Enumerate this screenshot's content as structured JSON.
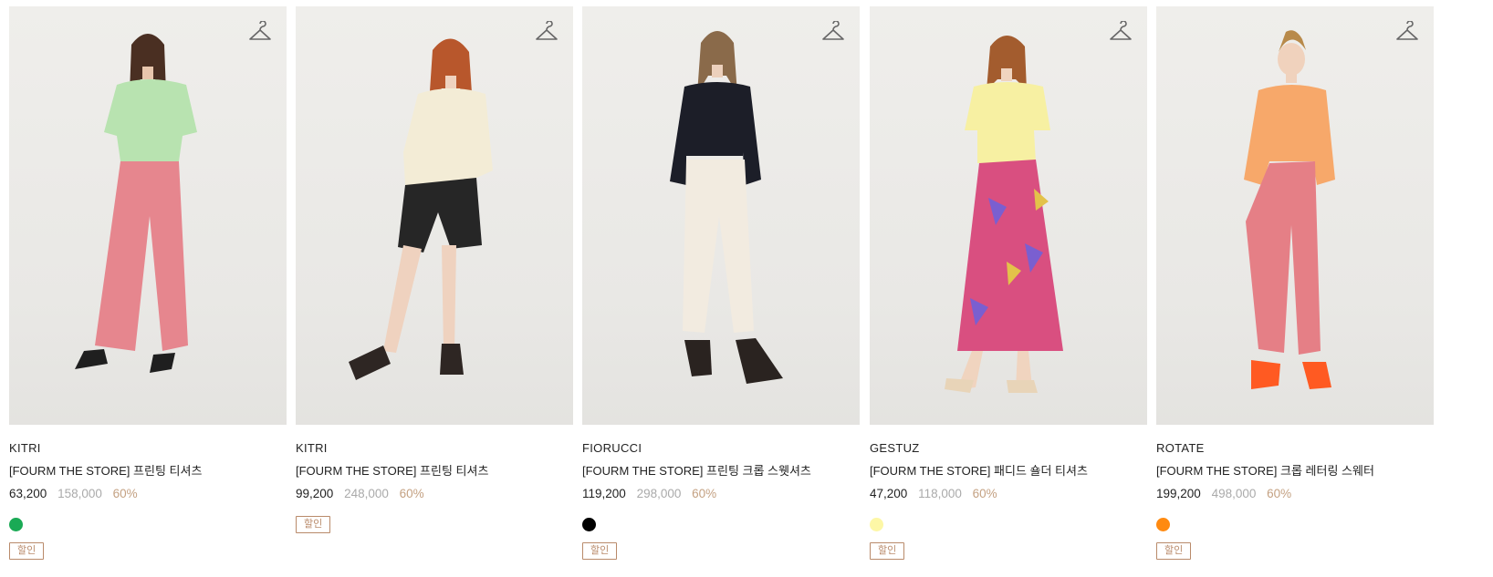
{
  "products": [
    {
      "brand": "KITRI",
      "name": "[FOURM THE STORE] 프린팅 티셔츠",
      "sale_price": "63,200",
      "original_price": "158,000",
      "discount": "60%",
      "swatch_color": "#1aaa55",
      "badge": "할인",
      "top_color": "#b8e3b0",
      "bottom_color": "#e6868e",
      "shoe_color": "#1f1f1f"
    },
    {
      "brand": "KITRI",
      "name": "[FOURM THE STORE] 프린팅 티셔츠",
      "sale_price": "99,200",
      "original_price": "248,000",
      "discount": "60%",
      "swatch_color": null,
      "badge": "할인",
      "top_color": "#f3ecd6",
      "bottom_color": "#262626",
      "shoe_color": "#2e2623"
    },
    {
      "brand": "FIORUCCI",
      "name": "[FOURM THE STORE] 프린팅 크롭 스웻셔츠",
      "sale_price": "119,200",
      "original_price": "298,000",
      "discount": "60%",
      "swatch_color": "#000000",
      "badge": "할인",
      "top_color": "#1c1e28",
      "bottom_color": "#f2ebe0",
      "shoe_color": "#2a2320"
    },
    {
      "brand": "GESTUZ",
      "name": "[FOURM THE STORE] 패디드 숄더 티셔츠",
      "sale_price": "47,200",
      "original_price": "118,000",
      "discount": "60%",
      "swatch_color": "#fdf7a6",
      "badge": "할인",
      "top_color": "#f7f0a2",
      "bottom_color": "#d94f80",
      "shoe_color": "#e8d4b8"
    },
    {
      "brand": "ROTATE",
      "name": "[FOURM THE STORE] 크롭 레터링 스웨터",
      "sale_price": "199,200",
      "original_price": "498,000",
      "discount": "60%",
      "swatch_color": "#ff8a10",
      "badge": "할인",
      "top_color": "#f7a86a",
      "bottom_color": "#e57f86",
      "shoe_color": "#ff5a22"
    }
  ],
  "icons": {
    "wishlist": "hanger-icon"
  }
}
